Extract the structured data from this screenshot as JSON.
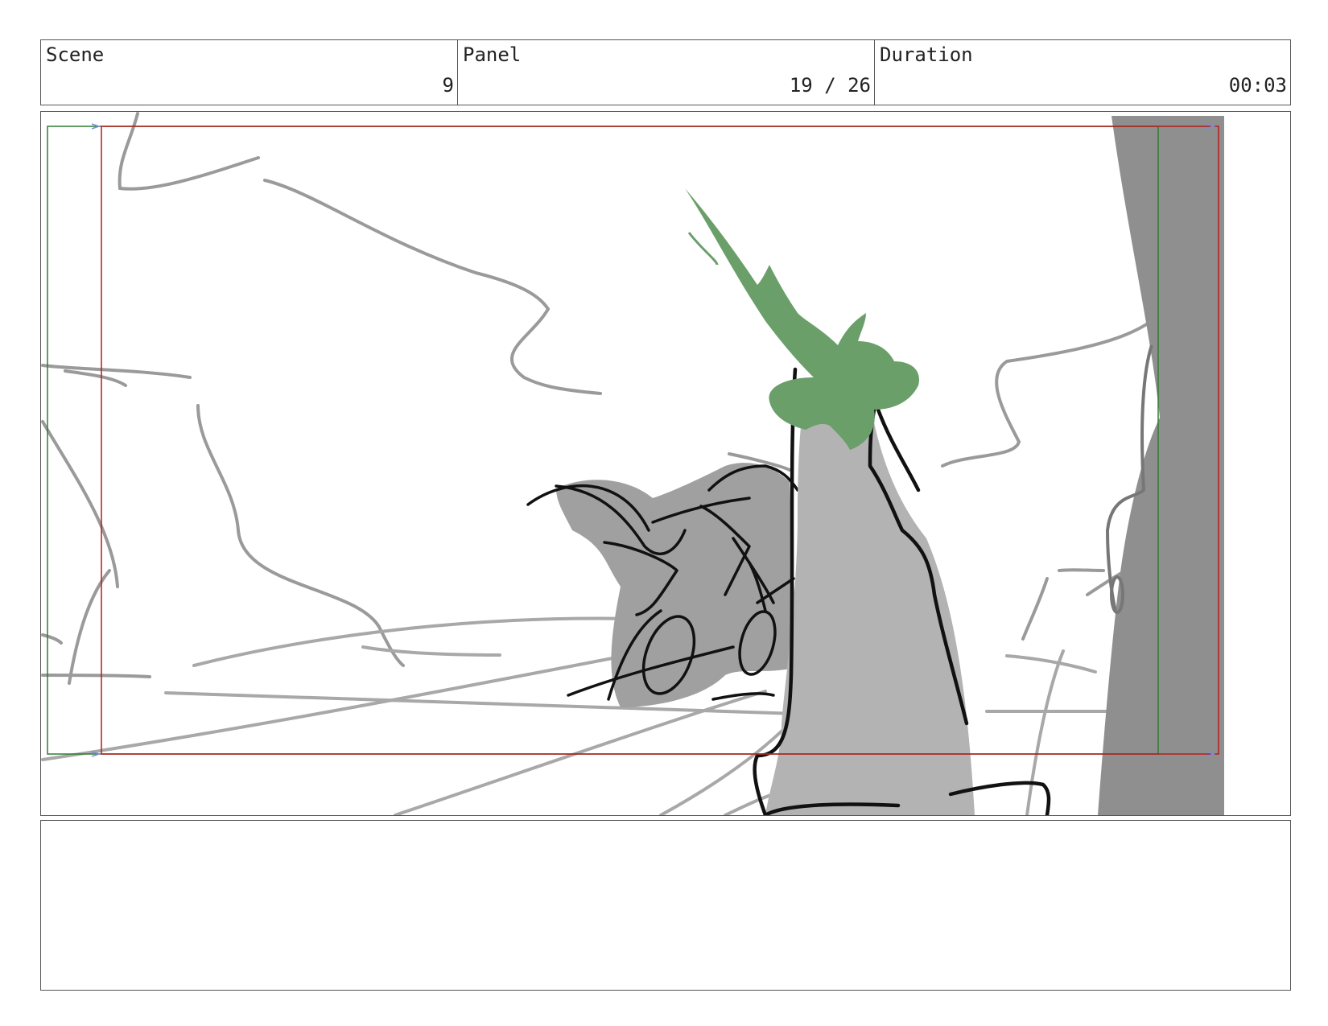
{
  "header": {
    "scene_label": "Scene",
    "scene_value": "9",
    "panel_label": "Panel",
    "panel_value": "19 / 26",
    "duration_label": "Duration",
    "duration_value": "00:03"
  },
  "colors": {
    "frame_border": "#555555",
    "safe_area_green": "#2e7d32",
    "action_area_red": "#b71c1c",
    "sketch_gray": "#9a9a9a",
    "fill_gray": "#b3b3b3",
    "dark_gray": "#8f8f8f",
    "ink_black": "#111111",
    "foliage_green": "#6a9f6a"
  },
  "notes": {
    "text": ""
  }
}
